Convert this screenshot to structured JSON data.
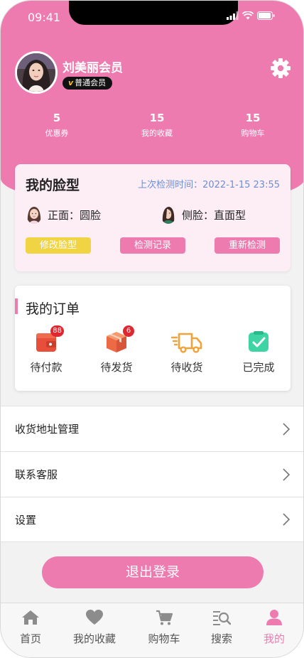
{
  "status_bar": {
    "time": "09:41"
  },
  "profile": {
    "name": "刘美丽会员",
    "badge_mark": "v",
    "badge_label": "普通会员"
  },
  "stats": [
    {
      "value": "5",
      "label": "优惠券"
    },
    {
      "value": "15",
      "label": "我的收藏"
    },
    {
      "value": "15",
      "label": "购物车"
    }
  ],
  "face_card": {
    "title": "我的脸型",
    "last_check": "上次检测时间：2022-1-15 23:55",
    "front": "正面：圆脸",
    "side": "侧脸：直面型",
    "buttons": {
      "edit": "修改脸型",
      "records": "检测记录",
      "recheck": "重新检测"
    },
    "colors": {
      "edit": "#f0d444",
      "records": "#ee7bb0",
      "recheck": "#ee7bb0"
    }
  },
  "orders": {
    "title": "我的订单",
    "items": [
      {
        "label": "待付款",
        "badge": "88",
        "icon": "wallet-icon"
      },
      {
        "label": "待发货",
        "badge": "6",
        "icon": "package-icon"
      },
      {
        "label": "待收货",
        "badge": "",
        "icon": "delivery-truck-icon"
      },
      {
        "label": "已完成",
        "badge": "",
        "icon": "completed-check-icon"
      }
    ]
  },
  "menu": [
    {
      "label": "收货地址管理"
    },
    {
      "label": "联系客服"
    },
    {
      "label": "设置"
    }
  ],
  "logout_label": "退出登录",
  "tabbar": {
    "active": "我的",
    "items": [
      {
        "label": "首页",
        "icon": "home-icon"
      },
      {
        "label": "我的收藏",
        "icon": "heart-icon"
      },
      {
        "label": "购物车",
        "icon": "cart-icon"
      },
      {
        "label": "搜索",
        "icon": "search-list-icon"
      },
      {
        "label": "我的",
        "icon": "user-icon"
      }
    ]
  },
  "colors": {
    "accent": "#ee7bb0",
    "badge": "#e0262e",
    "link_blue": "#6b8fd6"
  }
}
